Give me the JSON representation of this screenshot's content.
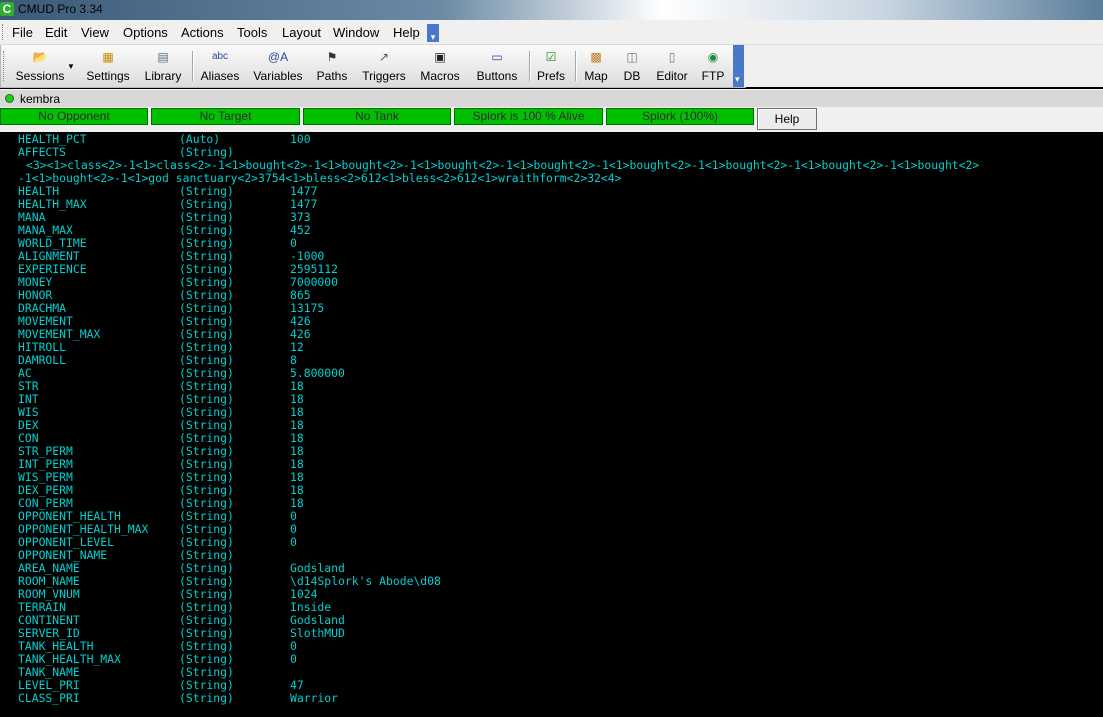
{
  "window": {
    "title": "CMUD Pro 3.34",
    "icon": "C"
  },
  "menu": [
    "File",
    "Edit",
    "View",
    "Options",
    "Actions",
    "Tools",
    "Layout",
    "Window",
    "Help"
  ],
  "toolbar": [
    {
      "label": "Sessions",
      "icon": "folder-icon",
      "glyph": "📂"
    },
    {
      "label": "Settings",
      "icon": "settings-icon",
      "glyph": "▦"
    },
    {
      "label": "Library",
      "icon": "library-icon",
      "glyph": "▤"
    },
    {
      "label": "Aliases",
      "icon": "aliases-icon",
      "glyph": "abc"
    },
    {
      "label": "Variables",
      "icon": "variables-icon",
      "glyph": "@A"
    },
    {
      "label": "Paths",
      "icon": "paths-icon",
      "glyph": "⚑"
    },
    {
      "label": "Triggers",
      "icon": "trigger-icon",
      "glyph": "↗"
    },
    {
      "label": "Macros",
      "icon": "macros-icon",
      "glyph": "▣"
    },
    {
      "label": "Buttons",
      "icon": "buttons-icon",
      "glyph": "▭"
    },
    {
      "label": "Prefs",
      "icon": "prefs-icon",
      "glyph": "☑"
    },
    {
      "label": "Map",
      "icon": "map-icon",
      "glyph": "▩"
    },
    {
      "label": "DB",
      "icon": "db-icon",
      "glyph": "◫"
    },
    {
      "label": "Editor",
      "icon": "editor-icon",
      "glyph": "▯"
    },
    {
      "label": "FTP",
      "icon": "ftp-icon",
      "glyph": "◉"
    }
  ],
  "session": {
    "name": "kembra",
    "status_color": "#22cc22"
  },
  "status": {
    "cells": [
      "No Opponent",
      "No Target",
      "No Tank",
      "Splork is 100 % Alive",
      "Splork (100%)"
    ],
    "help_label": "Help",
    "cell_color": "#00c000"
  },
  "terminal": {
    "text_color": "#00d0d0",
    "rows": [
      {
        "name": "HEALTH_PCT",
        "type": "(Auto)",
        "value": "100"
      },
      {
        "name": "AFFECTS",
        "type": "(String)",
        "value": ""
      },
      {
        "cont": "<3><1>class<2>-1<1>class<2>-1<1>bought<2>-1<1>bought<2>-1<1>bought<2>-1<1>bought<2>-1<1>bought<2>-1<1>bought<2>-1<1>bought<2>-1<1>bought<2>"
      },
      {
        "cont": "-1<1>bought<2>-1<1>god sanctuary<2>3754<1>bless<2>612<1>bless<2>612<1>wraithform<2>32<4>"
      },
      {
        "name": "HEALTH",
        "type": "(String)",
        "value": "1477"
      },
      {
        "name": "HEALTH_MAX",
        "type": "(String)",
        "value": "1477"
      },
      {
        "name": "MANA",
        "type": "(String)",
        "value": "373"
      },
      {
        "name": "MANA_MAX",
        "type": "(String)",
        "value": "452"
      },
      {
        "name": "WORLD_TIME",
        "type": "(String)",
        "value": "0"
      },
      {
        "name": "ALIGNMENT",
        "type": "(String)",
        "value": "-1000"
      },
      {
        "name": "EXPERIENCE",
        "type": "(String)",
        "value": "2595112"
      },
      {
        "name": "MONEY",
        "type": "(String)",
        "value": "7000000"
      },
      {
        "name": "HONOR",
        "type": "(String)",
        "value": "865"
      },
      {
        "name": "DRACHMA",
        "type": "(String)",
        "value": "13175"
      },
      {
        "name": "MOVEMENT",
        "type": "(String)",
        "value": "426"
      },
      {
        "name": "MOVEMENT_MAX",
        "type": "(String)",
        "value": "426"
      },
      {
        "name": "HITROLL",
        "type": "(String)",
        "value": "12"
      },
      {
        "name": "DAMROLL",
        "type": "(String)",
        "value": "8"
      },
      {
        "name": "AC",
        "type": "(String)",
        "value": "5.800000"
      },
      {
        "name": "STR",
        "type": "(String)",
        "value": "18"
      },
      {
        "name": "INT",
        "type": "(String)",
        "value": "18"
      },
      {
        "name": "WIS",
        "type": "(String)",
        "value": "18"
      },
      {
        "name": "DEX",
        "type": "(String)",
        "value": "18"
      },
      {
        "name": "CON",
        "type": "(String)",
        "value": "18"
      },
      {
        "name": "STR_PERM",
        "type": "(String)",
        "value": "18"
      },
      {
        "name": "INT_PERM",
        "type": "(String)",
        "value": "18"
      },
      {
        "name": "WIS_PERM",
        "type": "(String)",
        "value": "18"
      },
      {
        "name": "DEX_PERM",
        "type": "(String)",
        "value": "18"
      },
      {
        "name": "CON_PERM",
        "type": "(String)",
        "value": "18"
      },
      {
        "name": "OPPONENT_HEALTH",
        "type": "(String)",
        "value": "0"
      },
      {
        "name": "OPPONENT_HEALTH_MAX",
        "type": "(String)",
        "value": "0"
      },
      {
        "name": "OPPONENT_LEVEL",
        "type": "(String)",
        "value": "0"
      },
      {
        "name": "OPPONENT_NAME",
        "type": "(String)",
        "value": ""
      },
      {
        "name": "AREA_NAME",
        "type": "(String)",
        "value": "Godsland"
      },
      {
        "name": "ROOM_NAME",
        "type": "(String)",
        "value": "\\d14Splork's Abode\\d08"
      },
      {
        "name": "ROOM_VNUM",
        "type": "(String)",
        "value": "1024"
      },
      {
        "name": "TERRAIN",
        "type": "(String)",
        "value": "Inside"
      },
      {
        "name": "CONTINENT",
        "type": "(String)",
        "value": "Godsland"
      },
      {
        "name": "SERVER_ID",
        "type": "(String)",
        "value": "SlothMUD"
      },
      {
        "name": "TANK_HEALTH",
        "type": "(String)",
        "value": "0"
      },
      {
        "name": "TANK_HEALTH_MAX",
        "type": "(String)",
        "value": "0"
      },
      {
        "name": "TANK_NAME",
        "type": "(String)",
        "value": ""
      },
      {
        "name": "LEVEL_PRI",
        "type": "(String)",
        "value": "47"
      },
      {
        "name": "CLASS_PRI",
        "type": "(String)",
        "value": "Warrior"
      }
    ]
  }
}
